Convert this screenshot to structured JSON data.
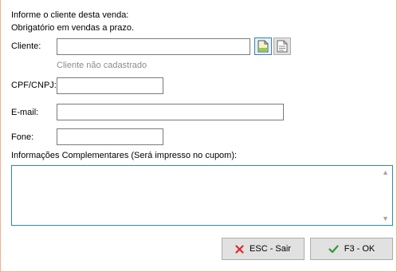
{
  "header": {
    "line1": "Informe o cliente desta venda:",
    "line2": "Obrigatório em vendas a prazo."
  },
  "form": {
    "cliente": {
      "label": "Cliente:",
      "value": "",
      "hint": "Cliente não cadastrado"
    },
    "cpf": {
      "label": "CPF/CNPJ:",
      "value": ""
    },
    "email": {
      "label": "E-mail:",
      "value": ""
    },
    "fone": {
      "label": "Fone:",
      "value": ""
    },
    "info": {
      "label": "Informações Complementares (Será impresso no cupom):",
      "value": ""
    }
  },
  "icons": {
    "new_client": "new-document-icon",
    "search_client": "document-list-icon",
    "cancel": "x-icon",
    "ok": "check-icon"
  },
  "buttons": {
    "cancel_label": "ESC - Sair",
    "ok_label": "F3 - OK"
  },
  "colors": {
    "window_border": "#f0b090",
    "cancel_icon": "#e02828",
    "ok_icon": "#2e9a3a",
    "memo_border": "#2c8aa8"
  }
}
